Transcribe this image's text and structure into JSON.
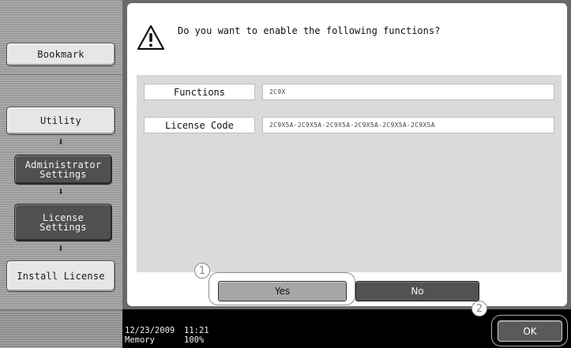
{
  "sidebar": {
    "bookmark_label": "Bookmark",
    "steps": [
      {
        "label": "Utility"
      },
      {
        "label": "Administrator\nSettings"
      },
      {
        "label": "License\nSettings"
      },
      {
        "label": "Install License"
      }
    ],
    "arrow_glyph": "⬇"
  },
  "dialog": {
    "question": "Do you want to enable the following functions?",
    "fields": [
      {
        "label": "Functions",
        "value": "2C9X"
      },
      {
        "label": "License Code",
        "value": "2C9X5A-2C9X5A-2C9X5A-2C9X5A-2C9X5A-2C9X5A"
      }
    ],
    "yes_label": "Yes",
    "no_label": "No"
  },
  "callouts": [
    "1",
    "2"
  ],
  "status": {
    "date": "12/23/2009",
    "time": "11:21",
    "memory_label": "Memory",
    "memory_value": "100%"
  },
  "ok_label": "OK",
  "icons": {
    "warning": "warning-triangle-icon",
    "arrow": "arrow-down-icon"
  },
  "colors": {
    "panel": "#9a9a9a",
    "frame": "#6a6a6a",
    "status_bar": "#000000",
    "dark_button": "#505050"
  }
}
